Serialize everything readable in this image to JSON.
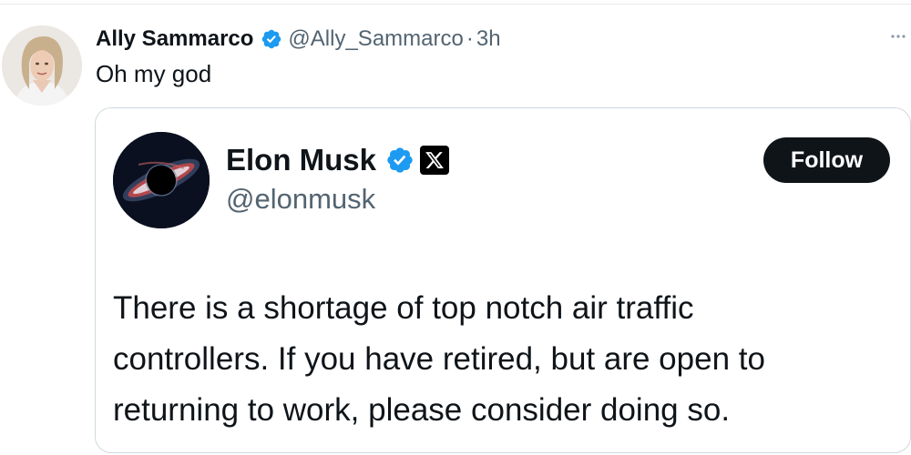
{
  "tweet": {
    "author_name": "Ally Sammarco",
    "author_handle": "@Ally_Sammarco",
    "separator": "·",
    "time": "3h",
    "text": "Oh my god"
  },
  "quote": {
    "author_name": "Elon Musk",
    "author_handle": "@elonmusk",
    "follow_label": "Follow",
    "text_lines": [
      "There is a shortage of top notch air traffic",
      "controllers. If you have retired, but are open to",
      "returning to work, please consider doing so."
    ]
  },
  "icons": {
    "verified": "verified-badge-icon",
    "affiliation": "x-logo-icon",
    "more": "more-options-icon"
  },
  "colors": {
    "verified_blue": "#1d9bf0",
    "text_primary": "#0f1419",
    "text_secondary": "#536471",
    "border": "#cfd9de",
    "follow_bg": "#0f1419"
  }
}
